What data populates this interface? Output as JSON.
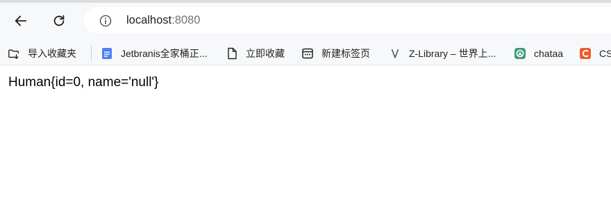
{
  "toolbar": {
    "url_host": "localhost",
    "url_port": ":8080"
  },
  "bookmarks": [
    {
      "label": "导入收藏夹",
      "icon": "folder-import-icon"
    },
    {
      "label": "Jetbranis全家桶正...",
      "icon": "doc-favicon-icon"
    },
    {
      "label": "立即收藏",
      "icon": "page-icon"
    },
    {
      "label": "新建标签页",
      "icon": "new-tab-icon"
    },
    {
      "label": "Z-Library – 世界上...",
      "icon": "zlibrary-icon"
    },
    {
      "label": "chataa",
      "icon": "chataa-favicon-icon"
    },
    {
      "label": "CS",
      "icon": "csdn-favicon-icon"
    }
  ],
  "page": {
    "body_text": "Human{id=0, name='null'}"
  },
  "colors": {
    "toolbar_bg": "#f7f8fa",
    "favicon_blue": "#4f7df2",
    "favicon_green": "#3a9b78",
    "favicon_orange": "#f05a28"
  }
}
